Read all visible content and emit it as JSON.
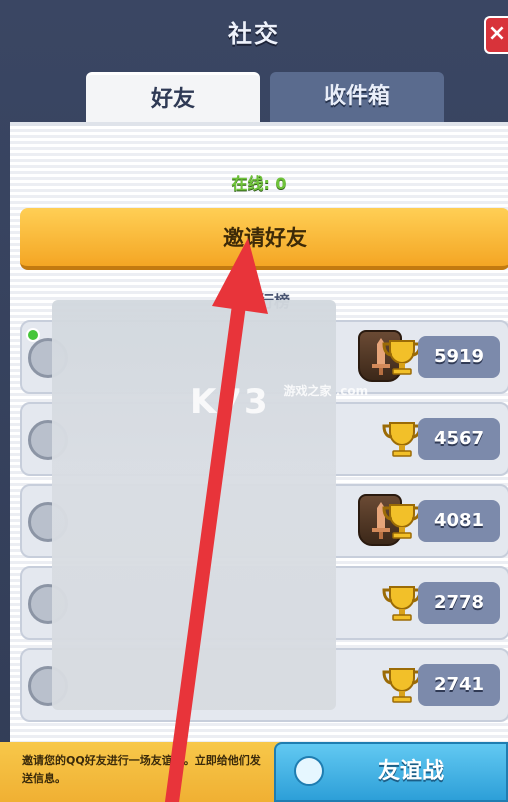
{
  "header": {
    "title": "社交",
    "close_label": "×"
  },
  "tabs": [
    {
      "label": "好友",
      "active": true
    },
    {
      "label": "收件箱",
      "active": false
    }
  ],
  "online": {
    "label": "在线: 0"
  },
  "invite_button": {
    "label": "邀请好友"
  },
  "ranking": {
    "label": "行榜"
  },
  "friends": [
    {
      "trophies": "5919",
      "online": true,
      "arena_badge": true
    },
    {
      "trophies": "4567",
      "online": false,
      "arena_badge": false
    },
    {
      "trophies": "4081",
      "online": false,
      "arena_badge": true
    },
    {
      "trophies": "2778",
      "online": false,
      "arena_badge": false
    },
    {
      "trophies": "2741",
      "online": false,
      "arena_badge": false
    }
  ],
  "footer": {
    "text": "邀请您的QQ好友进行一场友谊战。立即给他们发送信息。",
    "friendly_battle_label": "友谊战"
  },
  "watermark": {
    "main": "K73",
    "sub": "游戏之家 .com"
  },
  "colors": {
    "accent_orange": "#f4a624",
    "panel_bg": "#323d57",
    "online_green": "#6fc33a",
    "button_blue": "#2d9fd8",
    "annotation_red": "#e8343a"
  }
}
